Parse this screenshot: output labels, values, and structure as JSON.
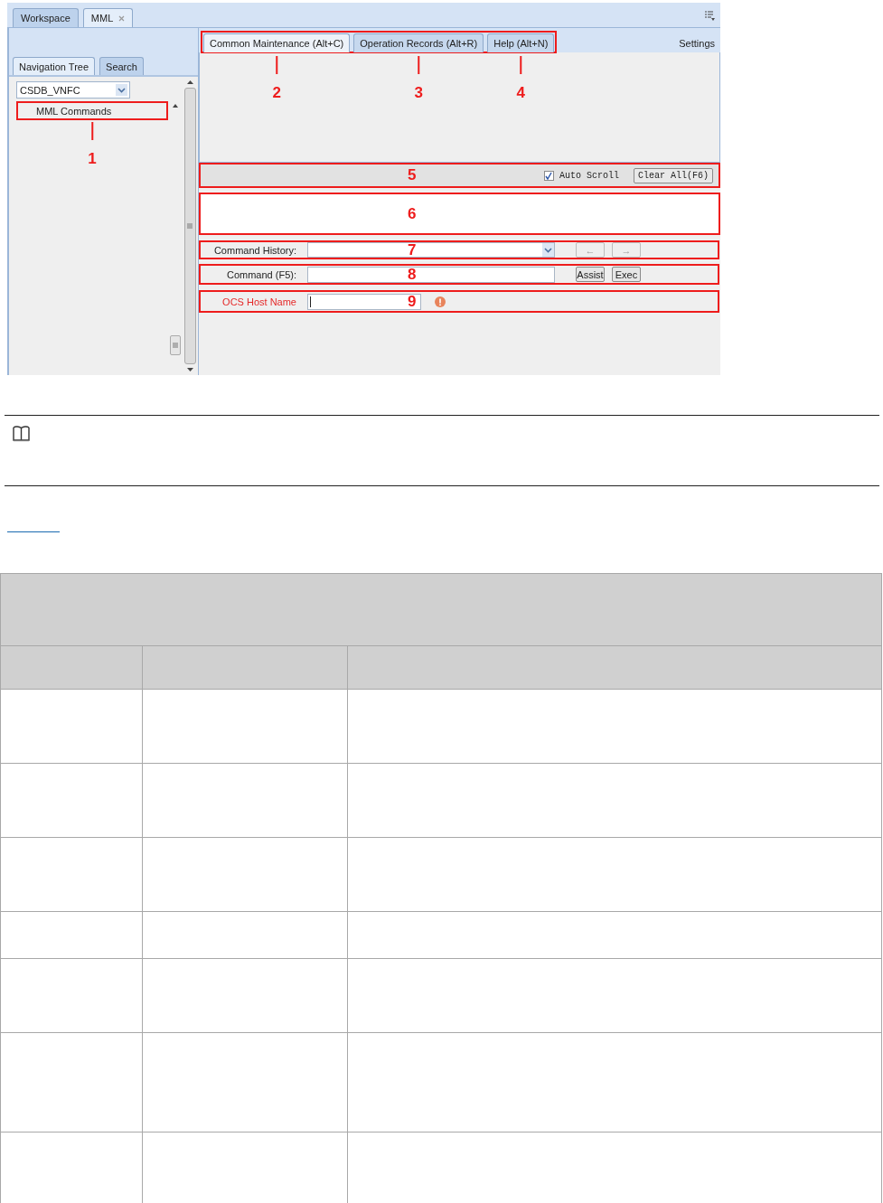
{
  "workspace_tabs": [
    {
      "label": "Workspace",
      "selected": false,
      "closable": false
    },
    {
      "label": "MML",
      "selected": true,
      "closable": true
    }
  ],
  "navigation": {
    "tabs": [
      {
        "label": "Navigation Tree",
        "selected": true
      },
      {
        "label": "Search",
        "selected": false
      }
    ],
    "ne_selector": {
      "value": "CSDB_VNFC"
    },
    "tree": [
      {
        "label": "MML Commands",
        "callout": "1"
      }
    ]
  },
  "function_tabs": [
    {
      "label": "Common Maintenance (Alt+C)",
      "selected": true,
      "callout": "2"
    },
    {
      "label": "Operation Records (Alt+R)",
      "selected": false,
      "callout": "3"
    },
    {
      "label": "Help (Alt+N)",
      "selected": false,
      "callout": "4"
    }
  ],
  "settings_link": "Settings",
  "log_toolbar": {
    "callout": "5",
    "auto_scroll": {
      "label": "Auto Scroll",
      "checked": true
    },
    "clear_button": "Clear All(F6)"
  },
  "output_pane": {
    "callout": "6"
  },
  "command_history": {
    "callout": "7",
    "label": "Command History:",
    "prev_button": "←",
    "next_button": "→",
    "disabled": true
  },
  "command": {
    "callout": "8",
    "label": "Command (F5):",
    "buttons": [
      "Assist",
      "Exec"
    ]
  },
  "parameters": [
    {
      "callout": "9",
      "label": "OCS Host Name",
      "required": true
    }
  ]
}
